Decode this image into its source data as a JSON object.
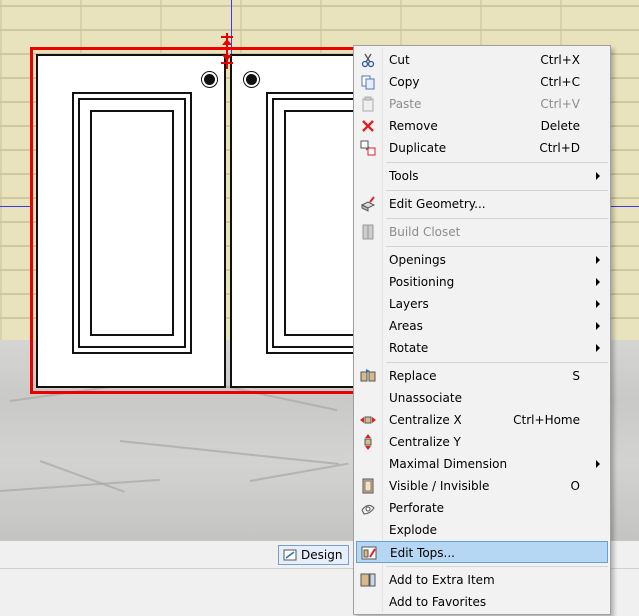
{
  "toolbar": {
    "design_label": "Design"
  },
  "menu": {
    "cut": {
      "label": "Cut",
      "shortcut": "Ctrl+X",
      "icon": "scissors-icon"
    },
    "copy": {
      "label": "Copy",
      "shortcut": "Ctrl+C",
      "icon": "copy-icon"
    },
    "paste": {
      "label": "Paste",
      "shortcut": "Ctrl+V",
      "icon": "paste-icon"
    },
    "remove": {
      "label": "Remove",
      "shortcut": "Delete",
      "icon": "remove-x-icon"
    },
    "duplicate": {
      "label": "Duplicate",
      "shortcut": "Ctrl+D",
      "icon": "duplicate-icon"
    },
    "tools": {
      "label": "Tools"
    },
    "edit_geometry": {
      "label": "Edit Geometry...",
      "icon": "edit-geometry-icon"
    },
    "build_closet": {
      "label": "Build Closet",
      "icon": "closet-icon"
    },
    "openings": {
      "label": "Openings"
    },
    "positioning": {
      "label": "Positioning"
    },
    "layers": {
      "label": "Layers"
    },
    "areas": {
      "label": "Areas"
    },
    "rotate": {
      "label": "Rotate"
    },
    "replace": {
      "label": "Replace",
      "shortcut": "S",
      "icon": "replace-icon"
    },
    "unassociate": {
      "label": "Unassociate"
    },
    "centralize_x": {
      "label": "Centralize X",
      "shortcut": "Ctrl+Home",
      "icon": "centralize-x-icon"
    },
    "centralize_y": {
      "label": "Centralize Y",
      "icon": "centralize-y-icon"
    },
    "maximal_dimension": {
      "label": "Maximal Dimension"
    },
    "visible_invisible": {
      "label": "Visible / Invisible",
      "shortcut": "O",
      "icon": "visibility-icon"
    },
    "perforate": {
      "label": "Perforate",
      "icon": "perforate-icon"
    },
    "explode": {
      "label": "Explode"
    },
    "edit_tops": {
      "label": "Edit Tops...",
      "icon": "edit-tops-icon"
    },
    "add_extra": {
      "label": "Add to Extra Item",
      "icon": "extra-item-icon"
    },
    "add_favorites": {
      "label": "Add to Favorites"
    }
  },
  "colors": {
    "menu_highlight": "#b5d7f3",
    "selection": "#e00000",
    "axis": "#3a3af0"
  }
}
